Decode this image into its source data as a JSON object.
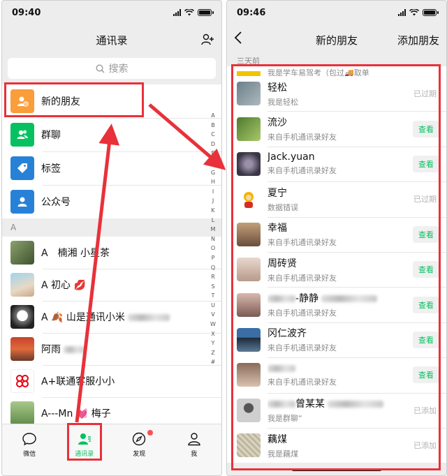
{
  "left": {
    "status_time": "09:40",
    "title": "通讯录",
    "search_placeholder": "搜索",
    "menu": [
      {
        "label": "新的朋友",
        "icon": "new-friend-icon",
        "color": "#fa9d3b"
      },
      {
        "label": "群聊",
        "icon": "group-chat-icon",
        "color": "#07c160"
      },
      {
        "label": "标签",
        "icon": "tag-icon",
        "color": "#2782d7"
      },
      {
        "label": "公众号",
        "icon": "official-account-icon",
        "color": "#2782d7"
      }
    ],
    "section_letter": "A",
    "contacts": [
      {
        "name": "A　楠湘 小星茶",
        "blurred": false
      },
      {
        "name": "A 初心 💋",
        "blurred": false
      },
      {
        "name": "A 🍂 山是通讯小米",
        "blurred": true
      },
      {
        "name": "阿雨",
        "blurred": true
      },
      {
        "name": "A+联通客服小小",
        "blurred": false
      },
      {
        "name": "A---Mn 💓 梅子",
        "blurred": false
      }
    ],
    "index_letters": [
      "A",
      "B",
      "C",
      "D",
      "E",
      "F",
      "G",
      "H",
      "I",
      "J",
      "K",
      "L",
      "M",
      "N",
      "O",
      "P",
      "Q",
      "R",
      "S",
      "T",
      "U",
      "V",
      "W",
      "X",
      "Y",
      "Z",
      "#"
    ],
    "tabs": [
      {
        "label": "微信",
        "icon": "chat-bubble-icon",
        "active": false
      },
      {
        "label": "通讯录",
        "icon": "contacts-icon",
        "active": true
      },
      {
        "label": "发现",
        "icon": "compass-icon",
        "active": false,
        "badge": true
      },
      {
        "label": "我",
        "icon": "person-icon",
        "active": false
      }
    ]
  },
  "right": {
    "status_time": "09:46",
    "title": "新的朋友",
    "add_action": "添加朋友",
    "section_label": "三天前",
    "partial_row_text": "我是学车易驾考（包过🚚取单",
    "friends": [
      {
        "name": "轻松",
        "sub": "我是轻松",
        "status": "已过期",
        "kind": "text"
      },
      {
        "name": "流沙",
        "sub": "来自手机通讯录好友",
        "status": "查看",
        "kind": "button"
      },
      {
        "name": "Jack.yuan",
        "sub": "来自手机通讯录好友",
        "status": "查看",
        "kind": "button"
      },
      {
        "name": "夏宁",
        "sub": "数据错误",
        "status": "已过期",
        "kind": "text"
      },
      {
        "name": "幸福",
        "sub": "来自手机通讯录好友",
        "status": "查看",
        "kind": "button"
      },
      {
        "name": "周砖贤",
        "sub": "来自手机通讯录好友",
        "status": "查看",
        "kind": "button"
      },
      {
        "name": "-静静",
        "sub": "来自手机通讯录好友",
        "status": "查看",
        "kind": "button",
        "blurred": true
      },
      {
        "name": "冈仁波齐",
        "sub": "来自手机通讯录好友",
        "status": "查看",
        "kind": "button"
      },
      {
        "name": "",
        "sub": "来自手机通讯录好友",
        "status": "查看",
        "kind": "button",
        "blurred": true
      },
      {
        "name": "曾某某",
        "sub": "我是群聊“",
        "status": "已添加",
        "kind": "text",
        "blurred": true
      },
      {
        "name": "藕煤",
        "sub": "我是藕煤",
        "status": "已添加",
        "kind": "text"
      }
    ]
  },
  "colors": {
    "accent_green": "#07c160",
    "highlight_red": "#e8313a",
    "badge_red": "#fa5151"
  }
}
